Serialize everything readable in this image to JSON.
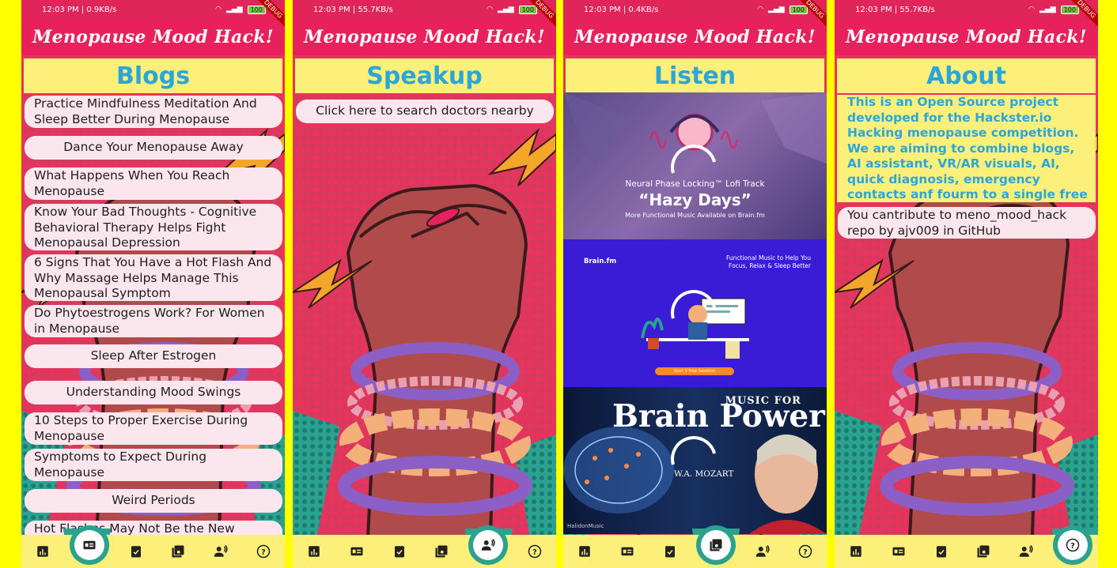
{
  "app_title": "Menopause Mood Hack!",
  "screens": [
    {
      "status": {
        "time": "12:03 PM",
        "speed": "0.9KB/s",
        "battery": "100"
      },
      "section": "Blogs",
      "blogs": [
        "Practice Mindfulness Meditation And Sleep Better During Menopause",
        "Dance Your Menopause Away",
        "What Happens When You Reach Menopause",
        "Know Your Bad Thoughts - Cognitive Behavioral Therapy Helps Fight Menopausal Depression",
        "6 Signs That You Have a Hot Flash And Why Massage Helps Manage This Menopausal Symptom",
        "Do Phytoestrogens Work? For Women in Menopause",
        "Sleep After Estrogen",
        "Understanding Mood Swings",
        "10 Steps to Proper Exercise During Menopause",
        "Symptoms to Expect During Menopause",
        "Weird Periods",
        "Hot Flashes May Not Be the New"
      ]
    },
    {
      "status": {
        "time": "12:03 PM",
        "speed": "55.7KB/s",
        "battery": "100"
      },
      "section": "Speakup",
      "search_button": "Click here to search doctors nearby"
    },
    {
      "status": {
        "time": "12:03 PM",
        "speed": "0.4KB/s",
        "battery": "100"
      },
      "section": "Listen",
      "tracks": [
        {
          "line1": "Neural Phase Locking™ Lofi Track",
          "line2": "“Hazy Days”",
          "line3": "More Functional Music Available on Brain.fm"
        },
        {
          "brand": "Brain.fm",
          "tagline1": "Functional Music to Help You",
          "tagline2": "Focus, Relax & Sleep Better",
          "cta": "Start 5 Free Sessions"
        },
        {
          "top": "MUSIC FOR",
          "title": "Brain Power",
          "composer": "W.A. MOZART",
          "label": "HalidonMusic"
        }
      ]
    },
    {
      "status": {
        "time": "12:03 PM",
        "speed": "55.7KB/s",
        "battery": "100"
      },
      "section": "About",
      "about": "This is an Open Source project developed for the Hackster.io Hacking menopause competition. We are aiming to combine blogs, AI assistant, VR/AR visuals, AI, quick diagnosis, emergency contacts anf fourm to a single free app",
      "contribute": "You cantribute to meno_mood_hack repo by ajv009 in GitHub"
    }
  ],
  "debug_label": "DEBUG",
  "nav_icons": [
    "insights-icon",
    "article-icon",
    "checklist-icon",
    "library-music-icon",
    "record-voice-icon",
    "help-icon"
  ],
  "colors": {
    "accent": "#e8215d",
    "banner": "#fdf07a",
    "title_text": "#2aa6db",
    "nav_notch": "#2aa28f"
  }
}
